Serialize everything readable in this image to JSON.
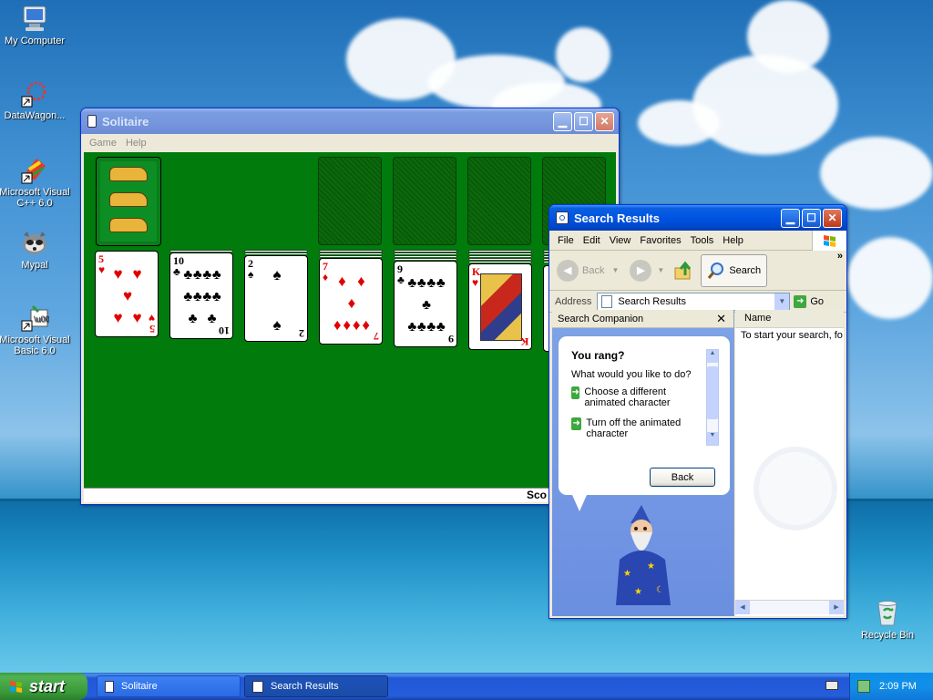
{
  "desktop": {
    "icons": [
      {
        "label": "My Computer"
      },
      {
        "label": "DataWagon..."
      },
      {
        "label": "Microsoft Visual C++ 6.0"
      },
      {
        "label": "Mypal"
      },
      {
        "label": "Microsoft Visual Basic 6.0"
      },
      {
        "label": "Recycle Bin"
      }
    ]
  },
  "solitaire": {
    "title": "Solitaire",
    "menu": [
      "Game",
      "Help"
    ],
    "status": "Sco",
    "tableau": [
      {
        "rank": "5",
        "suit": "♥",
        "color": "red"
      },
      {
        "rank": "10",
        "suit": "♣",
        "color": "black"
      },
      {
        "rank": "2",
        "suit": "♠",
        "color": "black"
      },
      {
        "rank": "7",
        "suit": "♦",
        "color": "red"
      },
      {
        "rank": "9",
        "suit": "♣",
        "color": "black"
      },
      {
        "rank": "K",
        "suit": "♥",
        "color": "red"
      }
    ]
  },
  "search": {
    "title": "Search Results",
    "menu": [
      "File",
      "Edit",
      "View",
      "Favorites",
      "Tools",
      "Help"
    ],
    "back_label": "Back",
    "search_label": "Search",
    "address_label": "Address",
    "address_value": "Search Results",
    "go_label": "Go",
    "companion_title": "Search Companion",
    "bubble_heading": "You rang?",
    "bubble_prompt": "What would you like to do?",
    "option1": "Choose a different animated character",
    "option2": "Turn off the animated character",
    "bubble_back": "Back",
    "column_name": "Name",
    "results_text": "To start your search, fo"
  },
  "taskbar": {
    "start_label": "start",
    "items": [
      "Solitaire",
      "Search Results"
    ],
    "clock": "2:09 PM"
  },
  "colors": {
    "felt": "#007b0c",
    "xp_blue": "#0054e3",
    "start_green": "#3a9a3a"
  }
}
